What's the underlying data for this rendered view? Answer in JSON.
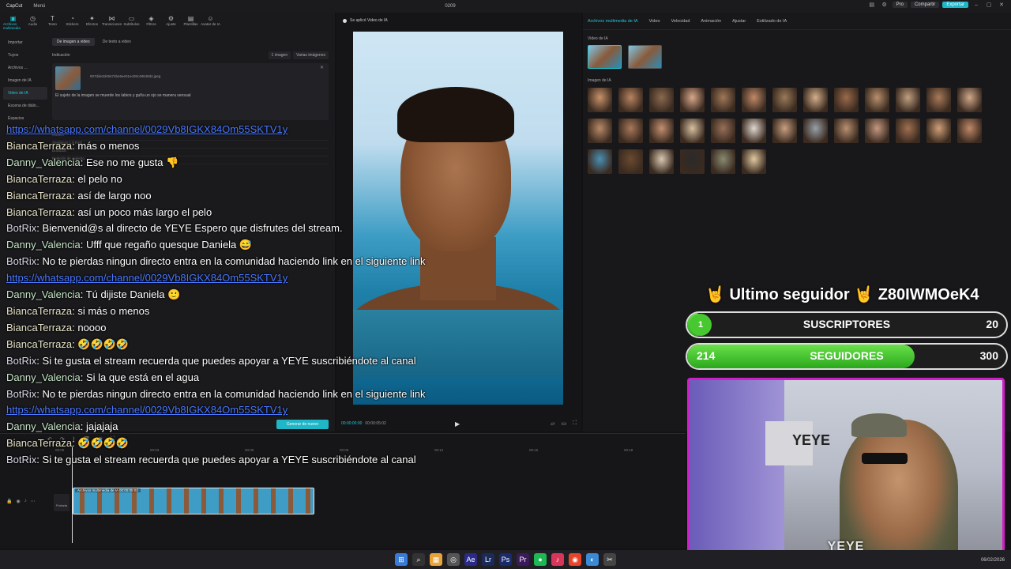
{
  "titlebar": {
    "app": "CapCut",
    "menu": "Menú",
    "doc_title": "0209",
    "pro": "Pro",
    "share": "Compartir",
    "export": "Exportar"
  },
  "tools": [
    {
      "label": "Archivos multimedia",
      "icon": "media-icon",
      "glyph": "▣"
    },
    {
      "label": "Audio",
      "icon": "audio-icon",
      "glyph": "◷"
    },
    {
      "label": "Texto",
      "icon": "text-icon",
      "glyph": "T"
    },
    {
      "label": "Stickers",
      "icon": "sticker-icon",
      "glyph": "◔"
    },
    {
      "label": "Efectos",
      "icon": "effects-icon",
      "glyph": "✦"
    },
    {
      "label": "Transiciones",
      "icon": "transition-icon",
      "glyph": "⋈"
    },
    {
      "label": "Subtítulos",
      "icon": "subtitles-icon",
      "glyph": "▭"
    },
    {
      "label": "Filtros",
      "icon": "filter-icon",
      "glyph": "◈"
    },
    {
      "label": "Ajuste",
      "icon": "adjust-icon",
      "glyph": "⚙"
    },
    {
      "label": "Plantillas",
      "icon": "template-icon",
      "glyph": "▤"
    },
    {
      "label": "Avatar de IA",
      "icon": "avatar-icon",
      "glyph": "☺"
    }
  ],
  "side_nav": [
    "Importar",
    "Tuyos",
    "Archivos ...",
    "Imagen de IA",
    "Video de IA",
    "Escena de diálo...",
    "Espacios"
  ],
  "gen": {
    "tab_image": "De imagen a video",
    "tab_text": "De texto a video",
    "indication": "Indicación",
    "one_image": "1 imagen",
    "many_images": "Varias imágenes",
    "file": "907dde3d49474be6ee01ec59c48648d4.jpeg",
    "prompt": "El sujeto de la imagen se muerde los labios y guña un ojo se manera sensual",
    "model": "Modelo",
    "model_value": "Seedance 1.0 Fast",
    "duration": "Duración",
    "aspect": "Relación de aspecto",
    "generate": "Generar de nuevo"
  },
  "chat": [
    {
      "type": "link",
      "text": "https://whatsapp.com/channel/0029Vb8IGKX84Om55SKTV1y"
    },
    {
      "user": "BiancaTerraza",
      "cls": "u-bianca",
      "text": "más o menos"
    },
    {
      "user": "Danny_Valencia",
      "cls": "u-danny",
      "text": "Ese no me gusta 👎"
    },
    {
      "user": "BiancaTerraza",
      "cls": "u-bianca",
      "text": "el pelo no"
    },
    {
      "user": "BiancaTerraza",
      "cls": "u-bianca",
      "text": "así de largo noo"
    },
    {
      "user": "BiancaTerraza",
      "cls": "u-bianca",
      "text": "así un poco más largo el pelo"
    },
    {
      "user": "BotRix",
      "cls": "u-botrix",
      "text": "Bienvenid@s al directo de YEYE Espero que disfrutes del stream."
    },
    {
      "user": "Danny_Valencia",
      "cls": "u-danny",
      "text": "Ufff que regaño quesque Daniela 😅"
    },
    {
      "user": "BotRix",
      "cls": "u-botrix",
      "text": "No te pierdas ningun directo entra en la comunidad haciendo link en el siguiente link"
    },
    {
      "type": "link",
      "text": "https://whatsapp.com/channel/0029Vb8IGKX84Om55SKTV1y"
    },
    {
      "user": "Danny_Valencia",
      "cls": "u-danny",
      "text": "Tú dijiste Daniela 🙂"
    },
    {
      "user": "BiancaTerraza",
      "cls": "u-bianca",
      "text": "si más o menos"
    },
    {
      "user": "BiancaTerraza",
      "cls": "u-bianca",
      "text": "noooo"
    },
    {
      "user": "BiancaTerraza",
      "cls": "u-bianca",
      "text": "🤣🤣🤣🤣"
    },
    {
      "user": "BotRix",
      "cls": "u-botrix",
      "text": "Si te gusta el stream recuerda que puedes apoyar a YEYE suscribiéndote al canal"
    },
    {
      "user": "Danny_Valencia",
      "cls": "u-danny",
      "text": "Si la que está en el agua"
    },
    {
      "user": "BotRix",
      "cls": "u-botrix",
      "text": "No te pierdas ningun directo entra en la comunidad haciendo link en el siguiente link"
    },
    {
      "type": "link",
      "text": "https://whatsapp.com/channel/0029Vb8IGKX84Om55SKTV1y"
    },
    {
      "user": "Danny_Valencia",
      "cls": "u-danny",
      "text": "jajajaja"
    },
    {
      "user": "BiancaTerraza",
      "cls": "u-bianca",
      "text": "🤣🤣🤣🤣"
    },
    {
      "user": "BotRix",
      "cls": "u-botrix",
      "text": "Si te gusta el stream recuerda que puedes apoyar a YEYE suscribiéndote al canal"
    }
  ],
  "player": {
    "header": "Se aplicó Video de IA",
    "time_current": "00:00:00:00",
    "time_total": "00:00:05:02"
  },
  "right": {
    "tabs": [
      "Archivos multimedia de IA",
      "Video",
      "Velocidad",
      "Animación",
      "Ajustar",
      "Estilizado de IA"
    ],
    "video_section": "Video de IA",
    "image_section": "Imagen de IA",
    "image_colors": [
      "#c8926a",
      "#b88460",
      "#8a6a50",
      "#d8a88a",
      "#a07858",
      "#c08a68",
      "#9a7a5a",
      "#d4b08a",
      "#9a6a4a",
      "#b8906c",
      "#c0a080",
      "#a87a58",
      "#d0a88a",
      "#b88a68",
      "#a8785a",
      "#c49070",
      "#d8c0a0",
      "#987058",
      "#e0d8d0",
      "#c8a080",
      "#98a0a8",
      "#b89070",
      "#c49880",
      "#a07050",
      "#d0a078",
      "#c08868",
      "#4a8fb4",
      "#6a4a30",
      "#d8c8b0",
      "#2a2a2a",
      "#8a8a70",
      "#e0c8a0"
    ]
  },
  "overlay": {
    "follower_label": "🤘 Ultimo seguidor 🤘 Z80IWMOeK4",
    "subs_label": "SUSCRIPTORES",
    "subs_current": "1",
    "subs_target": "20",
    "subs_fraction": 0.05,
    "follows_label": "SEGUIDORES",
    "follows_current": "214",
    "follows_target": "300",
    "follows_fraction": 0.713,
    "cam_caption": "YEYE",
    "cam_brand": "YEYE"
  },
  "timeline": {
    "ruler": [
      "00:00",
      "00:03",
      "00:06",
      "00:09",
      "00:12",
      "00:15",
      "00:18"
    ],
    "clip_label": "Archivos multimedia de IA  00:00:05:02",
    "portada": "Portada"
  },
  "taskbar": [
    "⊞",
    "⌕",
    "▦",
    "◎",
    "Ae",
    "Lr",
    "Ps",
    "Pr",
    "●",
    "♪",
    "◉",
    "◐",
    "✂"
  ],
  "clock": "06/02/2026"
}
